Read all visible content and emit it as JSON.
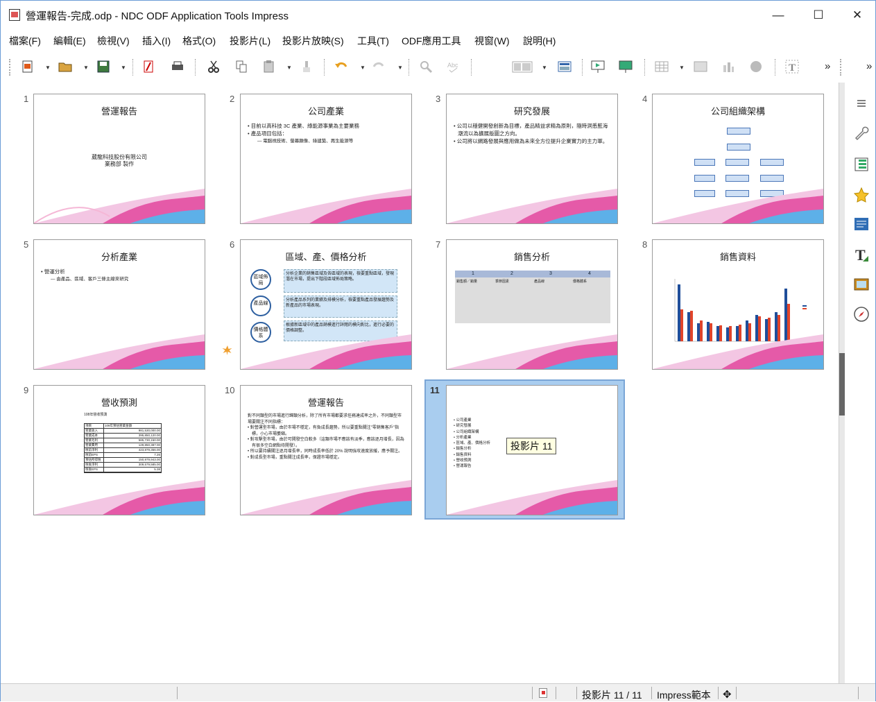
{
  "window": {
    "title": "營運報告-完成.odp - NDC ODF Application Tools Impress",
    "minimize": "—",
    "maximize": "☐",
    "close": "✕"
  },
  "menu": [
    "檔案(F)",
    "編輯(E)",
    "檢視(V)",
    "插入(I)",
    "格式(O)",
    "投影片(L)",
    "投影片放映(S)",
    "工具(T)",
    "ODF應用工具",
    "視窗(W)",
    "說明(H)"
  ],
  "toolbar": {
    "overflow": "»",
    "overflow2": "»"
  },
  "slides": [
    {
      "num": "1",
      "title": "營運報告",
      "body": [
        "葳龍科技股份有限公司",
        "業務部 製作"
      ]
    },
    {
      "num": "2",
      "title": "公司產業",
      "bullets": [
        "目前以高科技 3C 產業、綠能源事業為主要業務",
        "產品項目包括："
      ],
      "sub": [
        "— 電腦視技術、螢幕顯像、綠建築、再生能源等"
      ]
    },
    {
      "num": "3",
      "title": "研究發展",
      "bullets": [
        "公司以穩健開發創新為目標，產品精益求精為原則，隨時洞悉藍海潮流以為擴展版圖之方向。",
        "公司將以網路發展與應用做為未來全方位提升企業實力的主力軍。"
      ]
    },
    {
      "num": "4",
      "title": "公司組織架構"
    },
    {
      "num": "5",
      "title": "分析產業",
      "bullets": [
        "營運分析"
      ],
      "sub": [
        "— 由產品、區域、客戶三條主線來研究"
      ]
    },
    {
      "num": "6",
      "title": "區域、產、價格分析",
      "circles": [
        "區域佈局",
        "產品線",
        "價格體系"
      ],
      "notes": [
        "分析企業的銷售區域及各區域的表現，檢要重點區域，發現潛在市場，提出下階段區域佈局策略。",
        "分析產品系列的業績及排模分析，檢要重點產品發展趨勢及新產品的市場表現。",
        "根據新區域中的產品銷模進行詳閱的模向對比，進行必要的價格調整。"
      ]
    },
    {
      "num": "7",
      "title": "銷售分析",
      "cols": [
        "1",
        "2",
        "3",
        "4"
      ],
      "heads": [
        "銷售額／銷量",
        "季節因素",
        "產品線",
        "價格體系"
      ]
    },
    {
      "num": "8",
      "title": "銷售資料"
    },
    {
      "num": "9",
      "title": "營收預測",
      "subtitle": "108年營收預測",
      "table_head": [
        "項目",
        "108年預估營業金額"
      ],
      "rows": [
        [
          "營業收入",
          "981,530,000.00"
        ],
        [
          "營業成本",
          "395,850,120.00"
        ],
        [
          "營業毛利",
          "585,730,150.00"
        ],
        [
          "營業費用",
          "129,850,387.00"
        ],
        [
          "稅前淨利",
          "423,879,356.00"
        ],
        [
          "稅前EPS",
          "7.26"
        ],
        [
          "預估所得稅",
          "150,979,943.00"
        ],
        [
          "稅後淨利",
          "309,579,585.00"
        ],
        [
          "稅後EPS",
          "5.38"
        ]
      ]
    },
    {
      "num": "10",
      "title": "營運報告",
      "intro": "對不同類型的市場進行歸類分析，除了所有市場都要求任務達成率之外，不同類型市場要關注不同指標：",
      "bullets": [
        "對營運型市場，由於市場不穩定，有負成長趨勢，所以要重點關注\"零銷售客戶\"指標，小心市場萎縮。",
        "對攻擊型市場，由於可開發空白較多（這類市場不應該有淡季，應該逐月增長，因為有很多空白網點待開發）。",
        "所以要持續關注逐月增長率，同時成長率低於 20% 說明強攻速度放緩，應予關注。",
        "對成長型市場，重點關注成長率，保證市場穩定。"
      ]
    },
    {
      "num": "11",
      "items": [
        "公司產業",
        "研究發展",
        "公司組織架構",
        "分析產業",
        "區域、產、價格分析",
        "銷售分析",
        "銷售資料",
        "營收預測",
        "營運報告"
      ]
    }
  ],
  "tooltip": "投影片 11",
  "status": {
    "slide": "投影片 11 / 11",
    "template": "Impress範本"
  },
  "colors": {
    "accent": "#6a9bd6",
    "selection": "#a9cdef",
    "chart_blue": "#1f4e9a",
    "chart_red": "#e0442a"
  }
}
